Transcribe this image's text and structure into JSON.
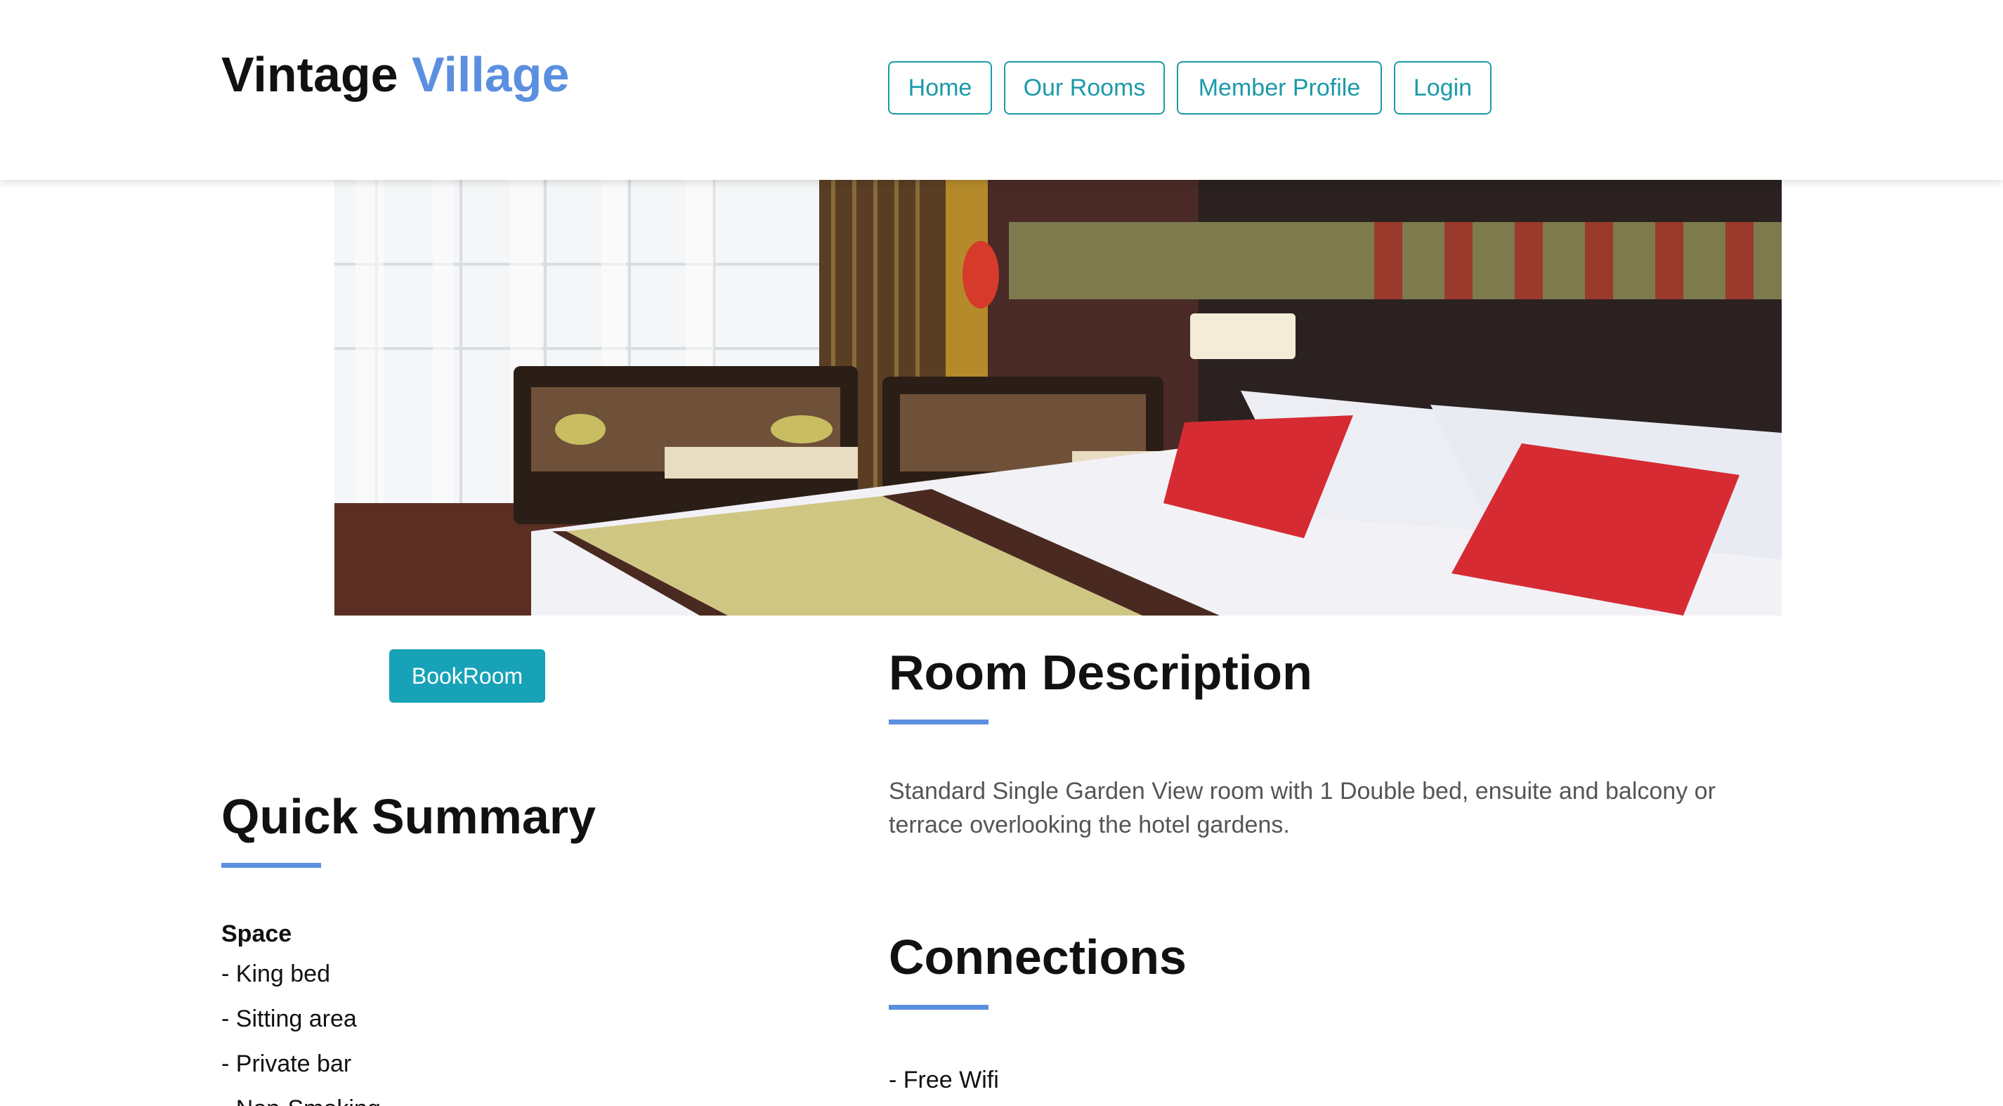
{
  "brand": {
    "name_part1": "Vintage",
    "name_part2": "Village",
    "accent_color": "#5b8fdf"
  },
  "nav": {
    "items": [
      {
        "label": "Home"
      },
      {
        "label": "Our Rooms"
      },
      {
        "label": "Member Profile"
      },
      {
        "label": "Login"
      }
    ],
    "color": "#1b9aaa"
  },
  "hero": {
    "image": "hotel-room-photo"
  },
  "booking": {
    "button_label": "BookRoom",
    "button_color": "#17a2b8"
  },
  "description": {
    "title": "Room Description",
    "text": "Standard Single Garden View room with 1 Double bed, ensuite and balcony or terrace overlooking the hotel gardens."
  },
  "connections": {
    "title": "Connections",
    "items": [
      "- Free Wifi"
    ]
  },
  "summary": {
    "title": "Quick Summary",
    "space_label": "Space",
    "items": [
      "- King bed",
      "- Sitting area",
      "- Private bar",
      "- Non-Smoking"
    ]
  }
}
